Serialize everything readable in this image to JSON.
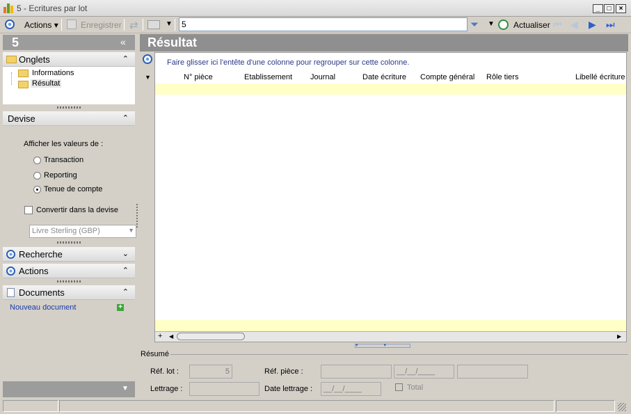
{
  "window": {
    "title": "5 -  Ecritures par lot",
    "minimize": "_",
    "maximize": "□",
    "close": "×"
  },
  "toolbar": {
    "actions_label": "Actions",
    "save_label": "Enregistrer",
    "search_value": "5",
    "refresh_label": "Actualiser"
  },
  "left": {
    "header_number": "5",
    "collapse_glyph": "«",
    "onglets": {
      "title": "Onglets",
      "items": [
        "Informations",
        "Résultat"
      ]
    },
    "devise": {
      "title": "Devise",
      "prompt": "Afficher les valeurs de :",
      "options": [
        "Transaction",
        "Reporting",
        "Tenue de compte"
      ],
      "selected": "Tenue de compte",
      "convert_label": "Convertir dans la devise",
      "convert_checked": false,
      "currency_value": "Livre Sterling (GBP)"
    },
    "recherche_title": "Recherche",
    "actions_title": "Actions",
    "documents": {
      "title": "Documents",
      "new_document": "Nouveau document"
    }
  },
  "result": {
    "title": "Résultat",
    "group_hint": "Faire glisser ici l'entête d'une colonne pour regrouper sur cette colonne.",
    "columns": [
      "N° pièce",
      "Etablissement",
      "Journal",
      "Date écriture",
      "Compte général",
      "Rôle tiers",
      "Libellé écriture"
    ]
  },
  "summary": {
    "title": "Résumé",
    "ref_lot_label": "Réf. lot :",
    "ref_lot_value": "5",
    "ref_piece_label": "Réf. pièce :",
    "date_placeholder": "__/__/____",
    "lettrage_label": "Lettrage :",
    "date_lettrage_label": "Date lettrage :",
    "total_label": "Total"
  },
  "colors": {
    "accent_blue": "#2e5fb3",
    "highlight_yellow": "#ffffc6",
    "header_gray": "#8f8f8f"
  }
}
